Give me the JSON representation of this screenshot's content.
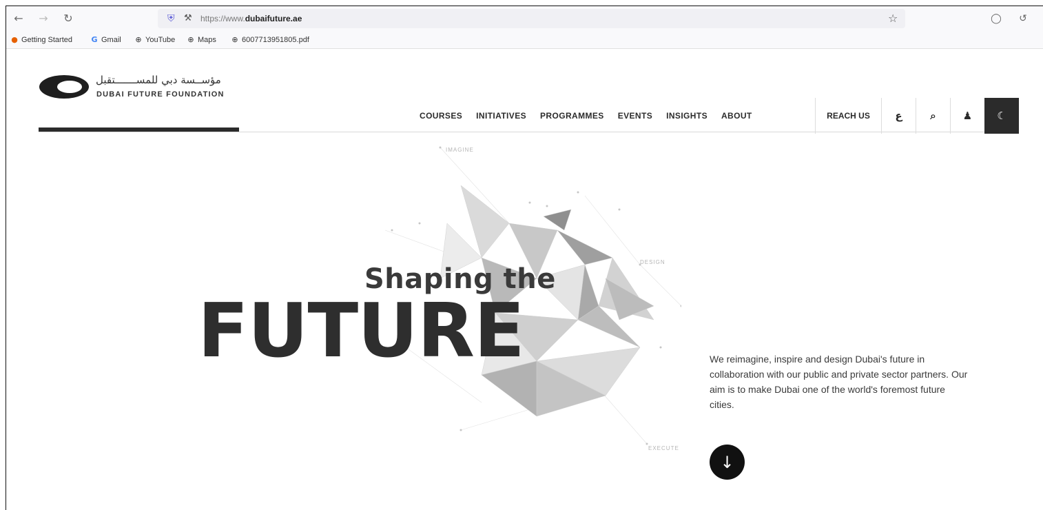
{
  "browser": {
    "url_prefix": "https://www.",
    "url_domain": "dubaifuture.ae",
    "icons": {
      "back": "←",
      "forward": "→",
      "reload": "↻",
      "shield": "⛨",
      "lock": "🔒",
      "star": "☆",
      "pocket": "▿",
      "extensions": "⎘"
    },
    "bookmarks": [
      {
        "label": "Getting Started",
        "icon": "🦊"
      },
      {
        "label": "Gmail",
        "icon": "G"
      },
      {
        "label": "YouTube",
        "icon": "⊕"
      },
      {
        "label": "Maps",
        "icon": "⊕"
      },
      {
        "label": "6007713951805.pdf",
        "icon": "⊕"
      }
    ]
  },
  "site": {
    "logo_arabic": "مؤســسة دبي للمســـــــتقبل",
    "logo_english": "DUBAI FUTURE FOUNDATION",
    "nav": [
      "COURSES",
      "INITIATIVES",
      "PROGRAMMES",
      "EVENTS",
      "INSIGHTS",
      "ABOUT"
    ],
    "reach_us": "REACH US",
    "lang_toggle": "ع",
    "search_icon": "⌕",
    "user_icon": "▲",
    "dark_mode_icon": "☾"
  },
  "hero": {
    "art_labels": {
      "imagine": "IMAGINE",
      "design": "DESIGN",
      "execute": "EXECUTE"
    },
    "title_small": "Shaping the",
    "title_big": "FUTURE",
    "description": "We reimagine, inspire and design Dubai's future in collaboration with our public and private sector partners. Our aim is to make Dubai one of the world's foremost future cities.",
    "scroll_icon": "↓"
  },
  "colors": {
    "text_dark": "#2b2b2b",
    "accent_dark": "#111111",
    "toolbar_bg": "#f9f9fb"
  }
}
